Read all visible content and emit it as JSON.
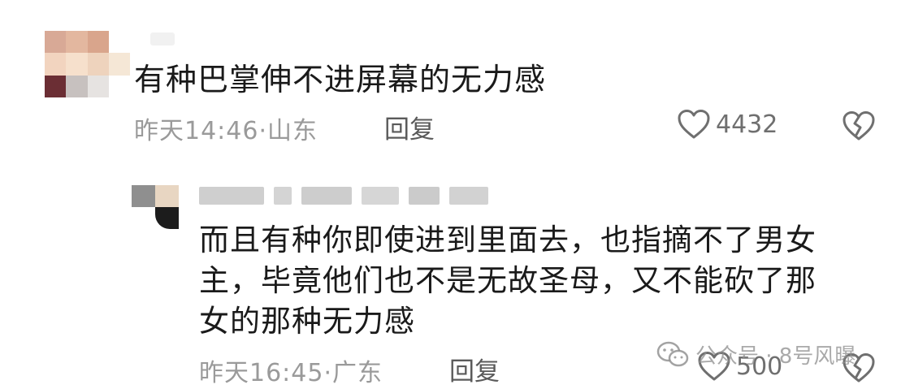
{
  "colors": {
    "text_primary": "#1a1a1a",
    "text_meta": "#9a9a9a",
    "reply_button": "#5a5a5a",
    "icon_gray": "#6f6f6f"
  },
  "comment": {
    "text": "有种巴掌伸不进屏幕的无力感",
    "time": "昨天14:46",
    "location": "山东",
    "reply_label": "回复",
    "like_icon": "heart-outline-icon",
    "likes": "4432",
    "dislike_icon": "broken-heart-icon"
  },
  "reply": {
    "lines": [
      "而且有种你即使进到里面去，也指摘不了男女",
      "主，毕竟他们也不是无故圣母，又不能砍了那",
      "女的那种无力感"
    ],
    "time": "昨天16:45",
    "location": "广东",
    "reply_label": "回复",
    "like_icon": "heart-outline-icon",
    "likes": "500",
    "dislike_icon": "broken-heart-icon"
  },
  "watermark": {
    "icon": "wechat-icon",
    "text": "公众号 · 8号风曝"
  }
}
